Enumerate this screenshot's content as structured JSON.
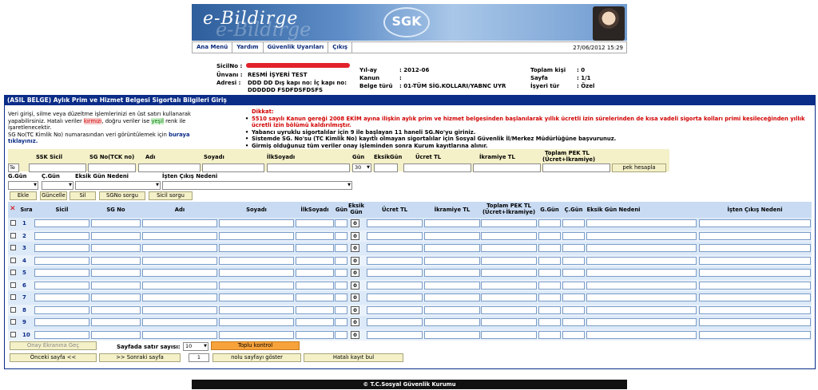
{
  "header": {
    "banner_title": "e-Bildirge",
    "logo_text": "SGK",
    "nav": [
      "Ana Menü",
      "Yardım",
      "Güvenlik Uyarıları",
      "Çıkış"
    ],
    "date": "27/06/2012 15:29"
  },
  "info": {
    "sicil_label": "SicilNo :",
    "unvan_label": "Ünvanı :",
    "unvan_value": "RESMİ İŞYERİ TEST",
    "adres_label": "Adresi :",
    "adres_value_1": "DDD DD Dış kapı no: İç kapı no:",
    "adres_value_2": "DDDDDD FSDFDSFDSFS",
    "yilay_label": "Yıl-ay",
    "yilay_value": ":   2012-06",
    "kanun_label": "Kanun",
    "kanun_value": ":",
    "belge_label": "Belge türü",
    "belge_value": ":   01-TÜM SİG.KOLLARI/YABNC UYR",
    "toplam_label": "Toplam kişi",
    "toplam_value": ": 0",
    "sayfa_label": "Sayfa",
    "sayfa_value": ": 1/1",
    "isyeri_label": "İşyeri tür",
    "isyeri_value": ": Özel"
  },
  "section_title": "(ASIL BELGE) Aylık Prim ve Hizmet Belgesi Sigortalı Bilgileri Giriş",
  "notes": {
    "left_1": "Veri girişi, silme veya düzeltme işlemlerinizi en üst satırı kullanarak yapabilirsiniz. Hatalı veriler ",
    "left_red": "kırmızı",
    "left_2": ", doğru veriler ise ",
    "left_green": "yeşil",
    "left_3": " renk ile işaretlenecektir.",
    "left_4": "SG No(TC Kimlik No) numarasından veri görüntülemek için ",
    "left_link": "buraya tıklayınız.",
    "dikkat": "Dikkat:",
    "items": [
      "5510 sayılı Kanun gereği 2008 EKİM ayına ilişkin aylık prim ve hizmet belgesinden başlanılarak yıllık ücretli izin sürelerinden de kısa vadeli sigorta kolları primi kesileceğinden yıllık ücretli izin bölümü kaldırılmıştır.",
      "Yabancı uyruklu sigortalılar için 9 ile başlayan 11 haneli SG.No'yu giriniz.",
      "Sistemde SG. No'su (TC Kimlik No) kayıtlı olmayan sigortalılar için Sosyal Güvenlik İl/Merkez Müdürlüğüne başvurunuz.",
      "Girmiş olduğunuz tüm veriler onay işleminden sonra Kurum kayıtlarına alınır."
    ]
  },
  "form": {
    "ssk_sicil": "SSK Sicil",
    "sg_no": "SG No(TCK no)",
    "adi": "Adı",
    "soyadi": "Soyadı",
    "ilk_soyadi": "İlkSoyadı",
    "gun": "Gün",
    "eksik_gun": "EksikGün",
    "ucret": "Ücret TL",
    "ikramiye": "İkramiye TL",
    "toplam_pek": "Toplam PEK TL",
    "toplam_pek_2": "(Ücret+İkramiye)",
    "te_value": "Te",
    "gun_value": "30",
    "pek_hesapla": "pek hesapla",
    "g_gun": "G.Gün",
    "c_gun": "Ç.Gün",
    "eksik_neden": "Eksik Gün Nedeni",
    "isten_cikis": "İşten Çıkış Nedeni",
    "buttons": [
      "Ekle",
      "Güncelle",
      "Sil",
      "SGNo sorgu",
      "Sicil sorgu"
    ]
  },
  "grid": {
    "headers": {
      "sira": "Sıra",
      "sicil": "Sicil",
      "sgno": "SG No",
      "adi": "Adı",
      "soyadi": "Soyadı",
      "ilksoyadi": "İlkSoyadı",
      "gun": "Gün",
      "eksik": "Eksik Gün",
      "ucret": "Ücret TL",
      "ikramiye": "İkramiye TL",
      "toplam": "Toplam PEK TL (Ücret+İkramiye)",
      "ggun": "G.Gün",
      "cgun": "Ç.Gün",
      "eksik_neden": "Eksik Gün Nedeni",
      "isten": "İşten Çıkış Nedeni"
    },
    "rows": [
      "1",
      "2",
      "3",
      "4",
      "5",
      "6",
      "7",
      "8",
      "9",
      "10"
    ],
    "zero": "0"
  },
  "bottom": {
    "onay": "Onay Ekranına Geç",
    "sayfada_label": "Sayfada satır sayısı:",
    "sayfada_value": "10",
    "toplu": "Toplu kontrol",
    "onceki": "Önceki sayfa <<",
    "sonraki": ">> Sonraki sayfa",
    "page_no": "1",
    "goster": "nolu sayfayı göster",
    "hatali": "Hatalı kayıt bul"
  },
  "footer": "© T.C.Sosyal Güvenlik Kurumu",
  "colors": {
    "section": "#0b2d88",
    "toplu": "#f7a23b",
    "red": "#d10000"
  }
}
